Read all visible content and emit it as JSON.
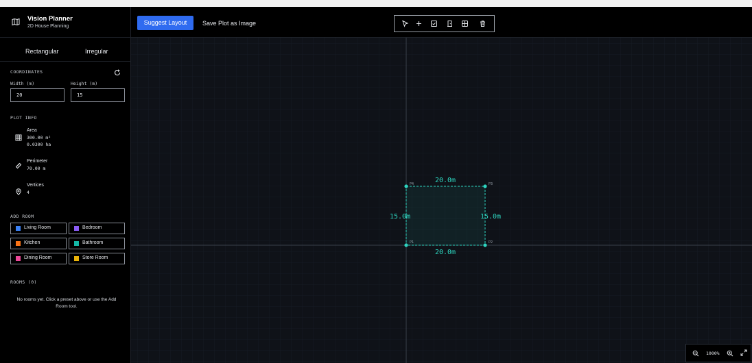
{
  "app": {
    "title": "Vision Planner",
    "subtitle": "2D House Planning",
    "icon": "map-icon"
  },
  "shape_tabs": [
    {
      "label": "Rectangular"
    },
    {
      "label": "Irregular"
    }
  ],
  "coordinates": {
    "heading": "COORDINATES",
    "reset_icon": "reset-icon",
    "width_label": "Width (m)",
    "width_value": "20",
    "height_label": "Height (m)",
    "height_value": "15"
  },
  "plot_info": {
    "heading": "PLOT INFO",
    "area_title": "Area",
    "area_m2": "300.00 m²",
    "area_ha": "0.0300 ha",
    "perimeter_title": "Perimeter",
    "perimeter_value": "70.00 m",
    "vertices_title": "Vertices",
    "vertices_value": "4"
  },
  "add_room": {
    "heading": "ADD ROOM",
    "rooms": [
      {
        "label": "Living Room",
        "color": "#3b82f6"
      },
      {
        "label": "Bedroom",
        "color": "#8b5cf6"
      },
      {
        "label": "Kitchen",
        "color": "#f97316"
      },
      {
        "label": "Bathroom",
        "color": "#14b8a6"
      },
      {
        "label": "Dining Room",
        "color": "#ec4899"
      },
      {
        "label": "Store Room",
        "color": "#eab308"
      }
    ]
  },
  "rooms_list": {
    "heading": "ROOMS (0)",
    "empty_message": "No rooms yet. Click a preset above or use the Add Room tool."
  },
  "toolbar": {
    "suggest_label": "Suggest Layout",
    "save_label": "Save Plot as Image",
    "tools": [
      "select-icon",
      "add-point-icon",
      "checkbox-icon",
      "door-icon",
      "grid-icon",
      "trash-icon"
    ]
  },
  "plot": {
    "accent": "#2dd4bf",
    "top_length": "20.0m",
    "bottom_length": "20.0m",
    "left_length": "15.0m",
    "right_length": "15.0m",
    "vertex_labels": [
      "P1",
      "P2",
      "P3",
      "P4"
    ]
  },
  "zoom": {
    "value": "1000%"
  }
}
